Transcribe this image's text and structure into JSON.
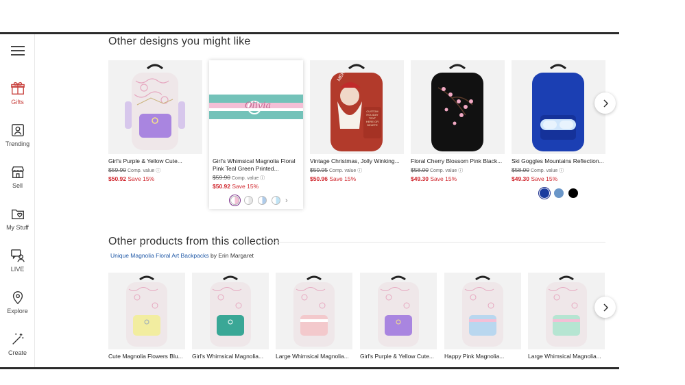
{
  "rail": {
    "items": [
      {
        "label": "Gifts",
        "icon": "gift-icon"
      },
      {
        "label": "Trending",
        "icon": "trending-icon"
      },
      {
        "label": "Sell",
        "icon": "store-icon"
      },
      {
        "label": "My Stuff",
        "icon": "folder-heart-icon"
      },
      {
        "label": "LIVE",
        "icon": "live-chat-icon"
      },
      {
        "label": "Explore",
        "icon": "location-pin-icon"
      },
      {
        "label": "Create",
        "icon": "magic-wand-icon"
      }
    ]
  },
  "designs": {
    "title": "Other designs you might like",
    "cards": [
      {
        "title": "Girl's Purple & Yellow Cute...",
        "orig": "$59.90",
        "comp": "Comp. value ⓘ",
        "sale": "$50.92",
        "save": "Save 15%"
      },
      {
        "title": "Girl's Whimsical Magnolia Floral Pink Teal Green Printed...",
        "orig": "$59.90",
        "comp": "Comp. value ⓘ",
        "sale": "$50.92",
        "save": "Save 15%",
        "banner_text": "Olivia"
      },
      {
        "title": "Vintage Christmas, Jolly Winking...",
        "orig": "$59.95",
        "comp": "Comp. value ⓘ",
        "sale": "$50.96",
        "save": "Save 15%",
        "image_text": "CUSTOM HOLIDAY TEXT HERE OR DELETE",
        "image_text_top": "MER"
      },
      {
        "title": "Floral Cherry Blossom Pink Black...",
        "orig": "$58.00",
        "comp": "Comp. value ⓘ",
        "sale": "$49.30",
        "save": "Save 15%"
      },
      {
        "title": "Ski Goggles Mountains Reflection...",
        "orig": "$58.00",
        "comp": "Comp. value ⓘ",
        "sale": "$49.30",
        "save": "Save 15%"
      }
    ],
    "hover_swatches": [
      "#f4bfd6",
      "#e8e8e8",
      "#aecbea",
      "#bfe3f5"
    ],
    "color_dots": [
      "#1a3b9e",
      "#6a96c8",
      "#000000"
    ]
  },
  "collection": {
    "title": "Other products from this collection",
    "link_text": "Unique Magnolia Floral Art Backpacks",
    "by_text": "by Erin Margaret",
    "cards": [
      {
        "title": "Cute Magnolia Flowers Blu...",
        "pocket": "#f2eda0"
      },
      {
        "title": "Girl's Whimsical Magnolia...",
        "pocket": "#3aa796"
      },
      {
        "title": "Large Whimsical Magnolia...",
        "pocket": "#f3c9cc"
      },
      {
        "title": "Girl's Purple & Yellow Cute...",
        "pocket": "#a985e0"
      },
      {
        "title": "Happy Pink Magnolia...",
        "pocket": "#b9d7ef"
      },
      {
        "title": "Large Whimsical Magnolia...",
        "pocket": "#b6e5d2"
      }
    ]
  }
}
